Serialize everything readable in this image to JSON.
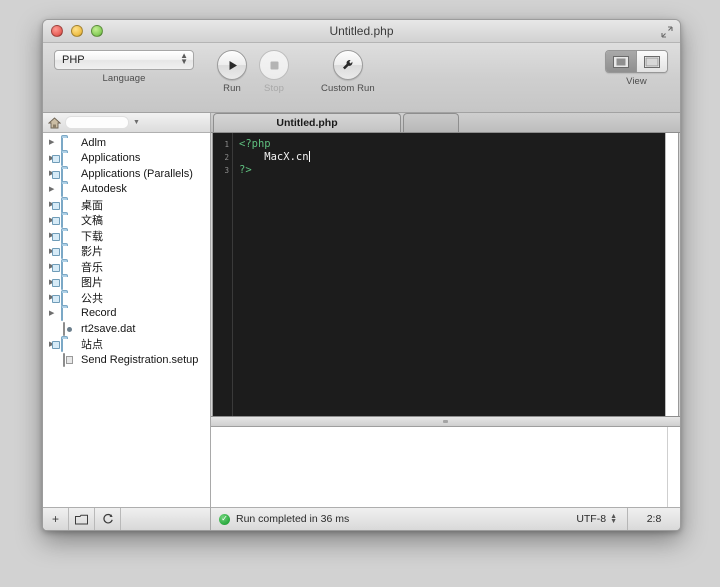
{
  "window": {
    "title": "Untitled.php",
    "fullscreen_icon": "expand-arrows-icon",
    "traffic_lights": [
      "close",
      "minimize",
      "zoom"
    ]
  },
  "toolbar": {
    "language_value": "PHP",
    "language_label": "Language",
    "run_label": "Run",
    "run_icon": "play-icon",
    "stop_label": "Stop",
    "stop_icon": "stop-square-icon",
    "custom_run_label": "Custom Run",
    "custom_run_icon": "wrench-icon",
    "view_label": "View",
    "view_segments": [
      "sidebar-view-icon",
      "full-view-icon"
    ]
  },
  "sidebar": {
    "path_home_icon": "home-icon",
    "path_value": "",
    "path_arrow_icon": "chevron-down-icon",
    "items": [
      {
        "label": "Adlm",
        "type": "folder",
        "expandable": true
      },
      {
        "label": "Applications",
        "type": "folder-badged",
        "expandable": true
      },
      {
        "label": "Applications (Parallels)",
        "type": "folder-badged",
        "expandable": true
      },
      {
        "label": "Autodesk",
        "type": "folder",
        "expandable": true
      },
      {
        "label": "桌面",
        "type": "folder-badged",
        "expandable": true
      },
      {
        "label": "文稿",
        "type": "folder-badged",
        "expandable": true
      },
      {
        "label": "下载",
        "type": "folder-badged",
        "expandable": true
      },
      {
        "label": "影片",
        "type": "folder-badged",
        "expandable": true
      },
      {
        "label": "音乐",
        "type": "folder-badged",
        "expandable": true
      },
      {
        "label": "图片",
        "type": "folder-badged",
        "expandable": true
      },
      {
        "label": "公共",
        "type": "folder-badged",
        "expandable": true
      },
      {
        "label": "Record",
        "type": "folder",
        "expandable": true
      },
      {
        "label": "rt2save.dat",
        "type": "file-dat",
        "expandable": false
      },
      {
        "label": "站点",
        "type": "folder-badged",
        "expandable": true
      },
      {
        "label": "Send Registration.setup",
        "type": "file-setup",
        "expandable": false
      }
    ],
    "footer": {
      "add_label": "+",
      "add_icon": "plus-icon",
      "folder_icon": "folder-icon",
      "refresh_icon": "refresh-icon"
    }
  },
  "editor": {
    "tabs": [
      {
        "label": "Untitled.php",
        "active": true
      }
    ],
    "line_numbers": [
      "1",
      "2",
      "3"
    ],
    "lines": [
      {
        "text": "<?php",
        "token": "tag"
      },
      {
        "text": "    MacX.cn",
        "token": "text"
      },
      {
        "text": "?>",
        "token": "tag"
      }
    ],
    "colors": {
      "background": "#1c1c1c",
      "tag": "#5fbf7f",
      "text": "#f2f2f2",
      "gutter": "#8d8d8d"
    }
  },
  "output": {
    "text": ""
  },
  "status": {
    "check_icon": "success-check-icon",
    "message": "Run completed in 36 ms",
    "encoding": "UTF-8",
    "encoding_stepper_icon": "stepper-icon",
    "cursor_position": "2:8"
  }
}
